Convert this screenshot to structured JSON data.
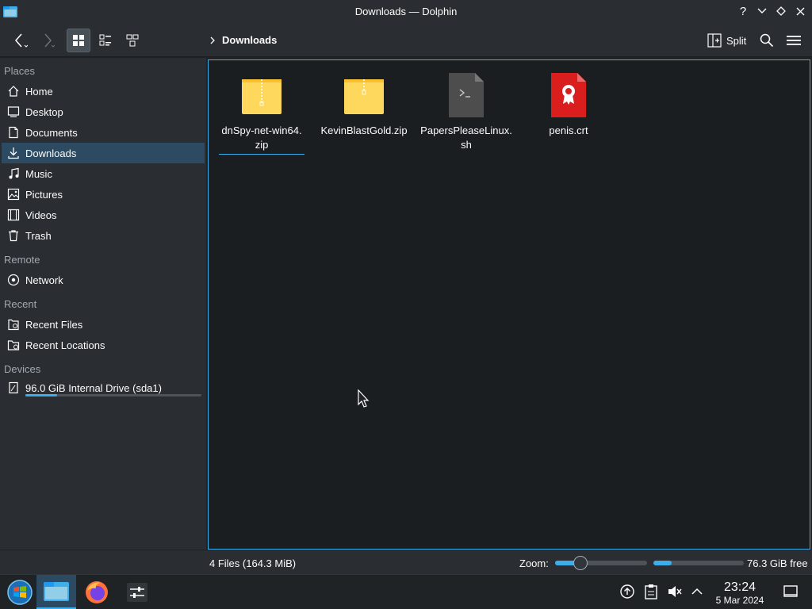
{
  "window": {
    "title": "Downloads — Dolphin",
    "help_glyph": "?",
    "min_glyph": "⌄",
    "max_glyph": "◇",
    "close_glyph": "✕"
  },
  "toolbar": {
    "breadcrumb_current": "Downloads",
    "split_label": "Split"
  },
  "sidebar": {
    "sections": {
      "places": "Places",
      "remote": "Remote",
      "recent": "Recent",
      "devices": "Devices"
    },
    "places": [
      {
        "label": "Home",
        "icon": "home-icon"
      },
      {
        "label": "Desktop",
        "icon": "desktop-icon"
      },
      {
        "label": "Documents",
        "icon": "documents-icon"
      },
      {
        "label": "Downloads",
        "icon": "downloads-icon"
      },
      {
        "label": "Music",
        "icon": "music-icon"
      },
      {
        "label": "Pictures",
        "icon": "pictures-icon"
      },
      {
        "label": "Videos",
        "icon": "videos-icon"
      },
      {
        "label": "Trash",
        "icon": "trash-icon"
      }
    ],
    "remote": [
      {
        "label": "Network",
        "icon": "network-icon"
      }
    ],
    "recent": [
      {
        "label": "Recent Files",
        "icon": "recent-files-icon"
      },
      {
        "label": "Recent Locations",
        "icon": "recent-locations-icon"
      }
    ],
    "devices": [
      {
        "label": "96.0 GiB Internal Drive (sda1)",
        "icon": "drive-icon",
        "usage_fraction": 0.18
      }
    ],
    "selected": "Downloads"
  },
  "files": [
    {
      "name_line1": "dnSpy-net-win64.",
      "name_line2": "zip",
      "type": "zip"
    },
    {
      "name_line1": "KevinBlastGold.zip",
      "name_line2": "",
      "type": "zip"
    },
    {
      "name_line1": "PapersPleaseLinux.",
      "name_line2": "sh",
      "type": "script"
    },
    {
      "name_line1": "penis.crt",
      "name_line2": "",
      "type": "certificate"
    }
  ],
  "statusbar": {
    "summary": "4 Files (164.3 MiB)",
    "zoom_label": "Zoom:",
    "zoom_fraction": 0.28,
    "free_space": "76.3 GiB free",
    "used_fraction": 0.2
  },
  "taskbar": {
    "time": "23:24",
    "date": "5 Mar 2024"
  },
  "colors": {
    "accent": "#3daee9",
    "folder_yellow": "#fdd85d",
    "certificate_red": "#da1e1e",
    "script_gray": "#4d4d4d"
  }
}
